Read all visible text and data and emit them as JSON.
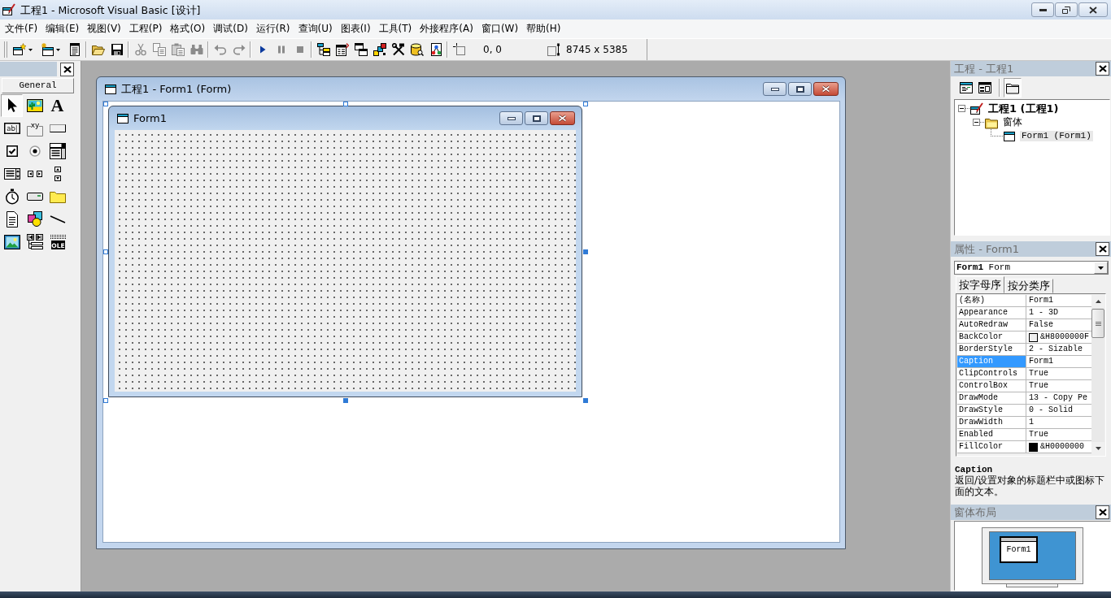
{
  "window": {
    "title": "工程1 - Microsoft Visual Basic [设计]"
  },
  "menu": [
    "文件(F)",
    "编辑(E)",
    "视图(V)",
    "工程(P)",
    "格式(O)",
    "调试(D)",
    "运行(R)",
    "查询(U)",
    "图表(I)",
    "工具(T)",
    "外接程序(A)",
    "窗口(W)",
    "帮助(H)"
  ],
  "toolbar": {
    "items": [
      {
        "kind": "add-project",
        "dropdown": true,
        "disabled": false
      },
      {
        "kind": "add-form",
        "dropdown": true,
        "disabled": false
      },
      {
        "kind": "menu-editor",
        "disabled": false
      },
      {
        "kind": "separator"
      },
      {
        "kind": "open",
        "disabled": false
      },
      {
        "kind": "save",
        "disabled": false
      },
      {
        "kind": "separator"
      },
      {
        "kind": "cut",
        "disabled": true
      },
      {
        "kind": "copy",
        "disabled": true
      },
      {
        "kind": "paste",
        "disabled": true
      },
      {
        "kind": "find",
        "disabled": true
      },
      {
        "kind": "separator"
      },
      {
        "kind": "undo",
        "disabled": true
      },
      {
        "kind": "redo",
        "disabled": true
      },
      {
        "kind": "separator"
      },
      {
        "kind": "run",
        "disabled": false
      },
      {
        "kind": "pause",
        "disabled": true
      },
      {
        "kind": "stop",
        "disabled": true
      },
      {
        "kind": "separator"
      },
      {
        "kind": "project-explorer",
        "disabled": false
      },
      {
        "kind": "properties",
        "disabled": false
      },
      {
        "kind": "form-layout",
        "disabled": false
      },
      {
        "kind": "object-browser",
        "disabled": false
      },
      {
        "kind": "toolbox",
        "disabled": false
      },
      {
        "kind": "data-view",
        "disabled": false
      },
      {
        "kind": "component-manager",
        "disabled": false
      },
      {
        "kind": "separator"
      }
    ],
    "position": "0, 0",
    "size": "8745 x 5385"
  },
  "toolbox": {
    "tab": "General",
    "tools": [
      {
        "kind": "pointer",
        "selected": true
      },
      {
        "kind": "picture",
        "selected": false
      },
      {
        "kind": "label",
        "glyph": "A",
        "selected": false
      },
      {
        "kind": "textbox",
        "glyph": "ab|",
        "selected": false
      },
      {
        "kind": "frame",
        "glyph": "xy",
        "selected": false
      },
      {
        "kind": "command",
        "selected": false
      },
      {
        "kind": "checkbox",
        "selected": false
      },
      {
        "kind": "option",
        "selected": false
      },
      {
        "kind": "combo",
        "selected": false
      },
      {
        "kind": "list",
        "selected": false
      },
      {
        "kind": "hscroll",
        "selected": false
      },
      {
        "kind": "vscroll",
        "selected": false
      },
      {
        "kind": "timer",
        "selected": false
      },
      {
        "kind": "drive",
        "selected": false
      },
      {
        "kind": "dir",
        "selected": false
      },
      {
        "kind": "file",
        "selected": false
      },
      {
        "kind": "shape",
        "selected": false
      },
      {
        "kind": "line",
        "selected": false
      },
      {
        "kind": "image",
        "selected": false
      },
      {
        "kind": "data",
        "selected": false
      },
      {
        "kind": "ole",
        "glyph": "OLE",
        "selected": false
      }
    ]
  },
  "form_window": {
    "title": "工程1 - Form1 (Form)",
    "form": {
      "caption": "Form1"
    },
    "handles": [
      {
        "filled": false
      },
      {
        "filled": false
      },
      {
        "filled": false
      },
      {
        "filled": false
      },
      {
        "filled": true
      },
      {
        "filled": false
      },
      {
        "filled": true
      },
      {
        "filled": true
      }
    ]
  },
  "project_panel": {
    "title": "工程 - 工程1",
    "buttons": [
      {
        "kind": "view-code",
        "pressed": false
      },
      {
        "kind": "view-object",
        "pressed": false
      },
      {
        "kind": "toggle-folders",
        "pressed": true
      }
    ],
    "tree": [
      {
        "kind": "project",
        "label": "工程1 (工程1)",
        "selected": false,
        "expanded": true,
        "children": [
          {
            "kind": "folder",
            "label": "窗体",
            "selected": false,
            "expanded": true,
            "children": [
              {
                "kind": "form",
                "label": "Form1 (Form1)",
                "selected": true
              }
            ]
          }
        ]
      }
    ]
  },
  "properties_panel": {
    "title": "属性 - Form1",
    "object": "**Form1** Form",
    "tabs": [
      {
        "label": "按字母序",
        "selected": true
      },
      {
        "label": "按分类序",
        "selected": false
      }
    ],
    "rows": [
      {
        "name": "(名称)",
        "value": "Form1",
        "selected": false
      },
      {
        "name": "Appearance",
        "value": "1 - 3D",
        "selected": false
      },
      {
        "name": "AutoRedraw",
        "value": "False",
        "selected": false
      },
      {
        "name": "BackColor",
        "value": "&H8000000F",
        "color": "#f0f0f0",
        "selected": false
      },
      {
        "name": "BorderStyle",
        "value": "2 - Sizable",
        "selected": false
      },
      {
        "name": "Caption",
        "value": "Form1",
        "selected": true
      },
      {
        "name": "ClipControls",
        "value": "True",
        "selected": false
      },
      {
        "name": "ControlBox",
        "value": "True",
        "selected": false
      },
      {
        "name": "DrawMode",
        "value": "13 - Copy Pe",
        "selected": false
      },
      {
        "name": "DrawStyle",
        "value": "0 - Solid",
        "selected": false
      },
      {
        "name": "DrawWidth",
        "value": "1",
        "selected": false
      },
      {
        "name": "Enabled",
        "value": "True",
        "selected": false
      },
      {
        "name": "FillColor",
        "value": "&H0000000",
        "color": "#000000",
        "selected": false
      }
    ],
    "description": {
      "title": "Caption",
      "text": "返回/设置对象的标题栏中或图标下面的文本。"
    }
  },
  "layout_panel": {
    "title": "窗体布局",
    "form_label": "Form1"
  }
}
